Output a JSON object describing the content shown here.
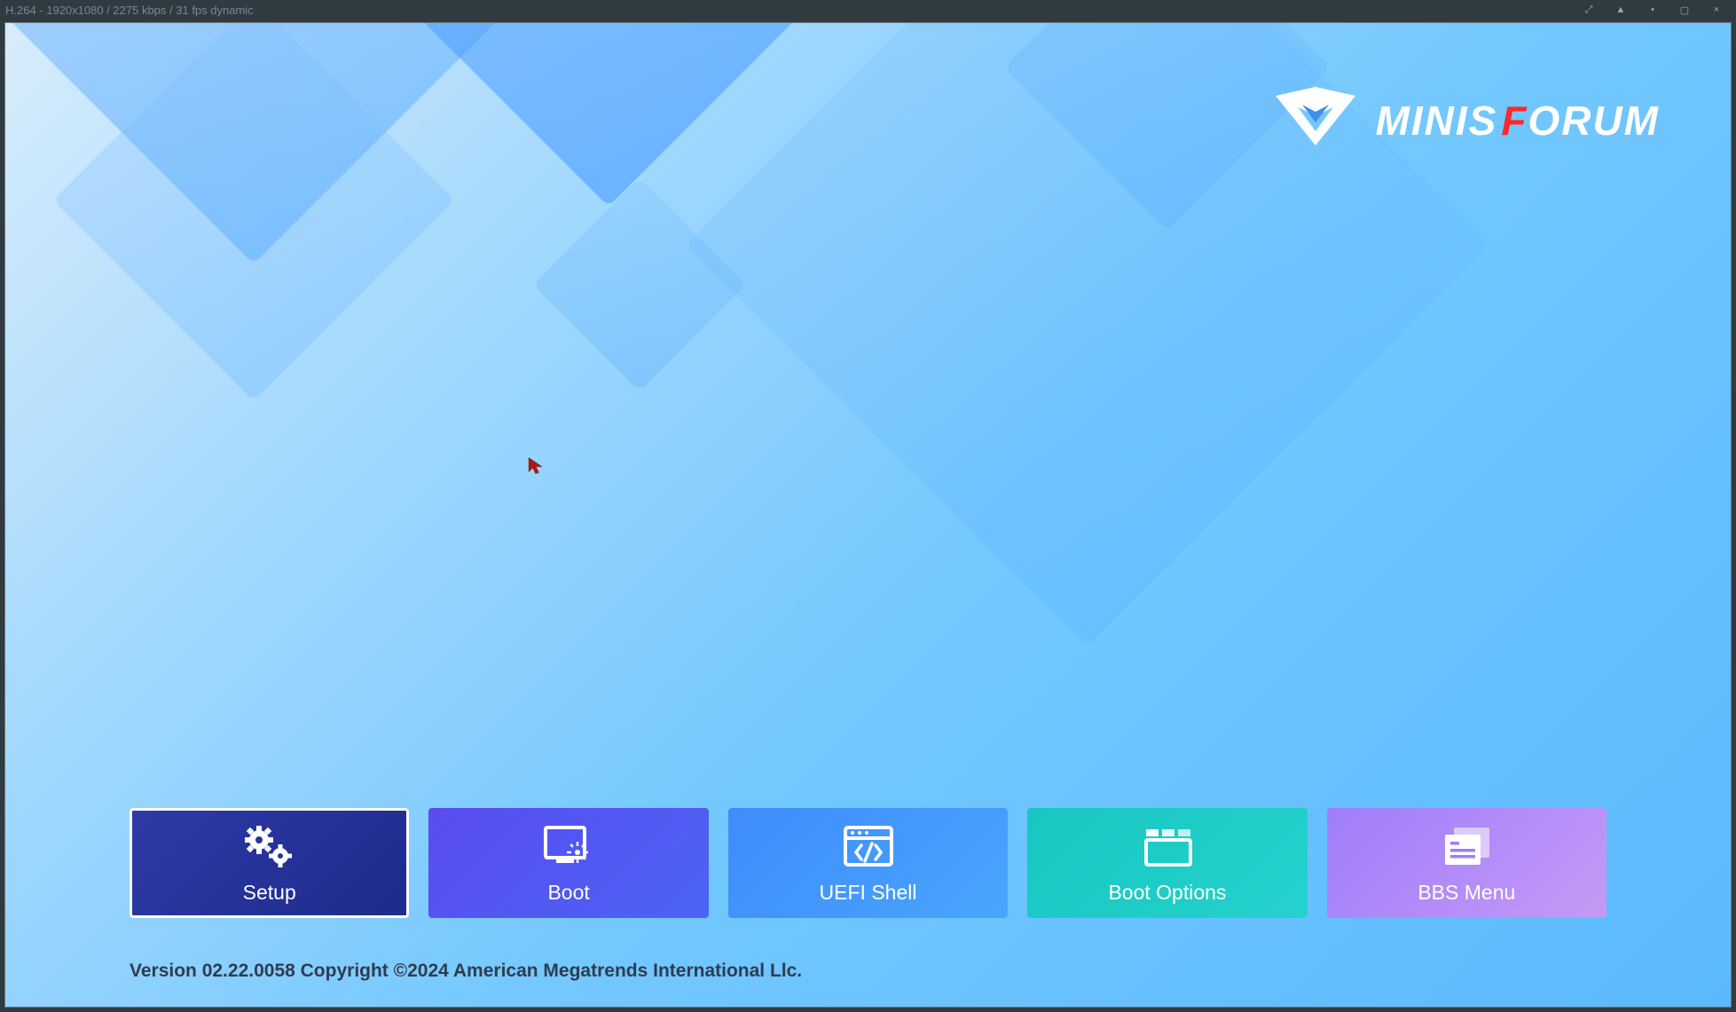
{
  "window": {
    "title": "H.264 - 1920x1080 / 2275 kbps / 31 fps dynamic"
  },
  "brand": {
    "name_part1": "MINIS",
    "name_part2": "F",
    "name_part3": "ORUM"
  },
  "tiles": [
    {
      "label": "Setup",
      "icon": "gears-icon",
      "selected": true
    },
    {
      "label": "Boot",
      "icon": "boot-monitor-icon",
      "selected": false
    },
    {
      "label": "UEFI Shell",
      "icon": "shell-window-icon",
      "selected": false
    },
    {
      "label": "Boot Options",
      "icon": "boot-options-icon",
      "selected": false
    },
    {
      "label": "BBS Menu",
      "icon": "bbs-menu-icon",
      "selected": false
    }
  ],
  "footer": {
    "text": "Version 02.22.0058 Copyright ©2024 American Megatrends International Llc."
  }
}
